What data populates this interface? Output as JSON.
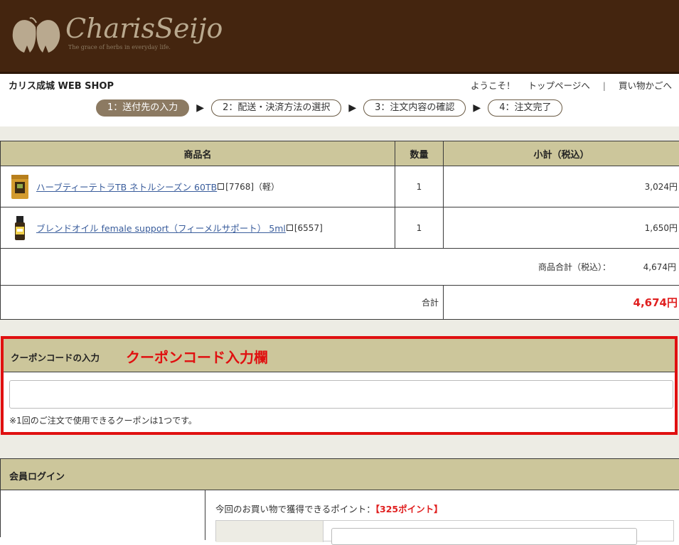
{
  "header": {
    "logo_text": "CharisSeijo",
    "logo_tagline": "The grace of herbs in everyday life.",
    "shop_name": "カリス成城 WEB SHOP",
    "nav": [
      "ようこそ！",
      "トップページへ",
      "買い物かごへ"
    ],
    "nav_separator": "|"
  },
  "steps": [
    {
      "label": "1：送付先の入力",
      "active": true
    },
    {
      "label": "2：配送・決済方法の選択",
      "active": false
    },
    {
      "label": "3：注文内容の確認",
      "active": false
    },
    {
      "label": "4：注文完了",
      "active": false
    }
  ],
  "step_arrow": "▶",
  "cart": {
    "headers": {
      "name": "商品名",
      "qty": "数量",
      "subtotal": "小計（税込）"
    },
    "items": [
      {
        "name": "ハーブティーテトラTB ネトルシーズン 60TB",
        "code": "[7768]（軽）",
        "qty": "1",
        "subtotal": "3,024円",
        "image": "tea-bag-package"
      },
      {
        "name": "ブレンドオイル female support（フィーメルサポート） 5ml",
        "code": "[6557]",
        "qty": "1",
        "subtotal": "1,650円",
        "image": "oil-bottle"
      }
    ],
    "goods_total_label": "商品合計（税込）：",
    "goods_total_value": "4,674円",
    "total_label": "合計",
    "total_value": "4,674円"
  },
  "coupon": {
    "title": "クーポンコードの入力",
    "annotation": "クーポンコード入力欄",
    "input_value": "",
    "note": "※1回のご注文で使用できるクーポンは1つです。"
  },
  "login": {
    "title": "会員ログイン",
    "points_text": "今回のお買い物で獲得できるポイント：",
    "points_value": "【325ポイント】"
  },
  "colors": {
    "header_bg": "#44250f",
    "table_header_bg": "#ccc69b",
    "band_bg": "#edece4",
    "accent_red": "#e02020",
    "active_step": "#8c7a62"
  }
}
